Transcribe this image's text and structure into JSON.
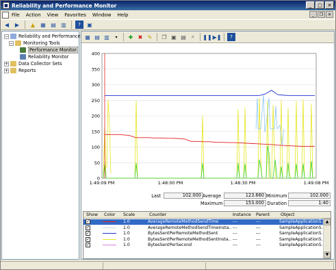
{
  "window": {
    "title": "Reliability and Performance Monitor"
  },
  "menu": [
    "File",
    "Action",
    "View",
    "Favorites",
    "Window",
    "Help"
  ],
  "tree": {
    "root": "Reliability and Performance",
    "monitoring_tools": "Monitoring Tools",
    "performance_monitor": "Performance Monitor",
    "reliability_monitor": "Reliability Monitor",
    "data_collector_sets": "Data Collector Sets",
    "reports": "Reports"
  },
  "chart": {
    "y_ticks": [
      "400",
      "350",
      "300",
      "250",
      "200",
      "150",
      "100",
      "50",
      "0"
    ],
    "x_ticks": [
      "1:49:09 PM",
      "1:48:00 PM",
      "1:48:30 PM",
      "1:49:08 PM"
    ]
  },
  "stats": {
    "last_label": "Last",
    "last_value": "102.000",
    "average_label": "Average",
    "average_value": "123.660",
    "minimum_label": "Minimum",
    "minimum_value": "102.000",
    "maximum_label": "Maximum",
    "maximum_value": "153.000",
    "duration_label": "Duration",
    "duration_value": "1:40"
  },
  "grid": {
    "headers": {
      "show": "Show",
      "color": "Color",
      "scale": "Scale",
      "counter": "Counter",
      "instance": "Instance",
      "parent": "Parent",
      "object": "Object"
    },
    "rows": [
      {
        "color": "#e02020",
        "scale": "1.0",
        "counter": "AverageRemoteMethodSendTime",
        "instance": "---",
        "parent": "---",
        "object": "SampleApplication5..."
      },
      {
        "color": "#d6d6d6",
        "scale": "1.0",
        "counter": "AverageRemoteMethodSendTimeInsta...",
        "instance": "---",
        "parent": "---",
        "object": "SampleApplication5..."
      },
      {
        "color": "#2030d0",
        "scale": "1.0",
        "counter": "BytesSentPerRemoteMethodSent",
        "instance": "---",
        "parent": "---",
        "object": "SampleApplication5..."
      },
      {
        "color": "#e8e820",
        "scale": "1.0",
        "counter": "BytesSentPerRemoteMethodSentInsta...",
        "instance": "---",
        "parent": "---",
        "object": "SampleApplication5..."
      },
      {
        "color": "#e080e0",
        "scale": "1.0",
        "counter": "BytesSentPerSecond",
        "instance": "---",
        "parent": "---",
        "object": "SampleApplication5..."
      }
    ]
  },
  "chart_data": {
    "type": "line",
    "ylim": [
      0,
      400
    ],
    "x_labels": [
      "1:49:09 PM",
      "1:48:00 PM",
      "1:48:30 PM",
      "1:49:08 PM"
    ],
    "series": [
      {
        "name": "AverageRemoteMethodSendTime",
        "color": "#e02020",
        "values": [
          140,
          140,
          140,
          139,
          137,
          130,
          130,
          130,
          129,
          129,
          128,
          128,
          127,
          125,
          118,
          118,
          117,
          117,
          115,
          115,
          114,
          114,
          113,
          112,
          111,
          110,
          109,
          108,
          106,
          105,
          104,
          103,
          102,
          102,
          102
        ]
      },
      {
        "name": "BytesSentPerRemoteMethodSent",
        "color": "#2030d0",
        "values": [
          265,
          265,
          265,
          265,
          265,
          265,
          265,
          265,
          265,
          265,
          265,
          265,
          265,
          265,
          265,
          265,
          265,
          265,
          265,
          265,
          265,
          265,
          265,
          265,
          265,
          265,
          270,
          282,
          268,
          266,
          265,
          265,
          265,
          265,
          265
        ]
      }
    ]
  }
}
